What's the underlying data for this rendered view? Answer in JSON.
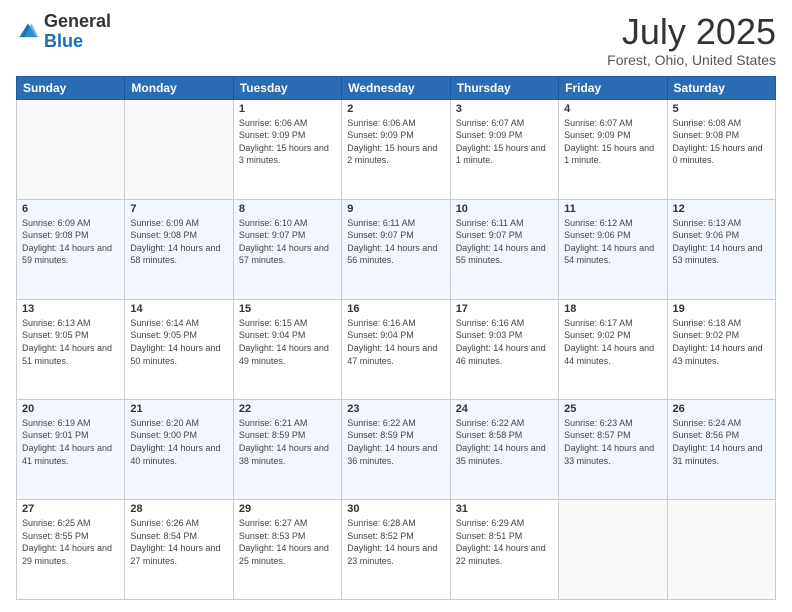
{
  "header": {
    "logo_line1": "General",
    "logo_line2": "Blue",
    "month": "July 2025",
    "location": "Forest, Ohio, United States"
  },
  "weekdays": [
    "Sunday",
    "Monday",
    "Tuesday",
    "Wednesday",
    "Thursday",
    "Friday",
    "Saturday"
  ],
  "weeks": [
    [
      {
        "day": "",
        "sunrise": "",
        "sunset": "",
        "daylight": ""
      },
      {
        "day": "",
        "sunrise": "",
        "sunset": "",
        "daylight": ""
      },
      {
        "day": "1",
        "sunrise": "Sunrise: 6:06 AM",
        "sunset": "Sunset: 9:09 PM",
        "daylight": "Daylight: 15 hours and 3 minutes."
      },
      {
        "day": "2",
        "sunrise": "Sunrise: 6:06 AM",
        "sunset": "Sunset: 9:09 PM",
        "daylight": "Daylight: 15 hours and 2 minutes."
      },
      {
        "day": "3",
        "sunrise": "Sunrise: 6:07 AM",
        "sunset": "Sunset: 9:09 PM",
        "daylight": "Daylight: 15 hours and 1 minute."
      },
      {
        "day": "4",
        "sunrise": "Sunrise: 6:07 AM",
        "sunset": "Sunset: 9:09 PM",
        "daylight": "Daylight: 15 hours and 1 minute."
      },
      {
        "day": "5",
        "sunrise": "Sunrise: 6:08 AM",
        "sunset": "Sunset: 9:08 PM",
        "daylight": "Daylight: 15 hours and 0 minutes."
      }
    ],
    [
      {
        "day": "6",
        "sunrise": "Sunrise: 6:09 AM",
        "sunset": "Sunset: 9:08 PM",
        "daylight": "Daylight: 14 hours and 59 minutes."
      },
      {
        "day": "7",
        "sunrise": "Sunrise: 6:09 AM",
        "sunset": "Sunset: 9:08 PM",
        "daylight": "Daylight: 14 hours and 58 minutes."
      },
      {
        "day": "8",
        "sunrise": "Sunrise: 6:10 AM",
        "sunset": "Sunset: 9:07 PM",
        "daylight": "Daylight: 14 hours and 57 minutes."
      },
      {
        "day": "9",
        "sunrise": "Sunrise: 6:11 AM",
        "sunset": "Sunset: 9:07 PM",
        "daylight": "Daylight: 14 hours and 56 minutes."
      },
      {
        "day": "10",
        "sunrise": "Sunrise: 6:11 AM",
        "sunset": "Sunset: 9:07 PM",
        "daylight": "Daylight: 14 hours and 55 minutes."
      },
      {
        "day": "11",
        "sunrise": "Sunrise: 6:12 AM",
        "sunset": "Sunset: 9:06 PM",
        "daylight": "Daylight: 14 hours and 54 minutes."
      },
      {
        "day": "12",
        "sunrise": "Sunrise: 6:13 AM",
        "sunset": "Sunset: 9:06 PM",
        "daylight": "Daylight: 14 hours and 53 minutes."
      }
    ],
    [
      {
        "day": "13",
        "sunrise": "Sunrise: 6:13 AM",
        "sunset": "Sunset: 9:05 PM",
        "daylight": "Daylight: 14 hours and 51 minutes."
      },
      {
        "day": "14",
        "sunrise": "Sunrise: 6:14 AM",
        "sunset": "Sunset: 9:05 PM",
        "daylight": "Daylight: 14 hours and 50 minutes."
      },
      {
        "day": "15",
        "sunrise": "Sunrise: 6:15 AM",
        "sunset": "Sunset: 9:04 PM",
        "daylight": "Daylight: 14 hours and 49 minutes."
      },
      {
        "day": "16",
        "sunrise": "Sunrise: 6:16 AM",
        "sunset": "Sunset: 9:04 PM",
        "daylight": "Daylight: 14 hours and 47 minutes."
      },
      {
        "day": "17",
        "sunrise": "Sunrise: 6:16 AM",
        "sunset": "Sunset: 9:03 PM",
        "daylight": "Daylight: 14 hours and 46 minutes."
      },
      {
        "day": "18",
        "sunrise": "Sunrise: 6:17 AM",
        "sunset": "Sunset: 9:02 PM",
        "daylight": "Daylight: 14 hours and 44 minutes."
      },
      {
        "day": "19",
        "sunrise": "Sunrise: 6:18 AM",
        "sunset": "Sunset: 9:02 PM",
        "daylight": "Daylight: 14 hours and 43 minutes."
      }
    ],
    [
      {
        "day": "20",
        "sunrise": "Sunrise: 6:19 AM",
        "sunset": "Sunset: 9:01 PM",
        "daylight": "Daylight: 14 hours and 41 minutes."
      },
      {
        "day": "21",
        "sunrise": "Sunrise: 6:20 AM",
        "sunset": "Sunset: 9:00 PM",
        "daylight": "Daylight: 14 hours and 40 minutes."
      },
      {
        "day": "22",
        "sunrise": "Sunrise: 6:21 AM",
        "sunset": "Sunset: 8:59 PM",
        "daylight": "Daylight: 14 hours and 38 minutes."
      },
      {
        "day": "23",
        "sunrise": "Sunrise: 6:22 AM",
        "sunset": "Sunset: 8:59 PM",
        "daylight": "Daylight: 14 hours and 36 minutes."
      },
      {
        "day": "24",
        "sunrise": "Sunrise: 6:22 AM",
        "sunset": "Sunset: 8:58 PM",
        "daylight": "Daylight: 14 hours and 35 minutes."
      },
      {
        "day": "25",
        "sunrise": "Sunrise: 6:23 AM",
        "sunset": "Sunset: 8:57 PM",
        "daylight": "Daylight: 14 hours and 33 minutes."
      },
      {
        "day": "26",
        "sunrise": "Sunrise: 6:24 AM",
        "sunset": "Sunset: 8:56 PM",
        "daylight": "Daylight: 14 hours and 31 minutes."
      }
    ],
    [
      {
        "day": "27",
        "sunrise": "Sunrise: 6:25 AM",
        "sunset": "Sunset: 8:55 PM",
        "daylight": "Daylight: 14 hours and 29 minutes."
      },
      {
        "day": "28",
        "sunrise": "Sunrise: 6:26 AM",
        "sunset": "Sunset: 8:54 PM",
        "daylight": "Daylight: 14 hours and 27 minutes."
      },
      {
        "day": "29",
        "sunrise": "Sunrise: 6:27 AM",
        "sunset": "Sunset: 8:53 PM",
        "daylight": "Daylight: 14 hours and 25 minutes."
      },
      {
        "day": "30",
        "sunrise": "Sunrise: 6:28 AM",
        "sunset": "Sunset: 8:52 PM",
        "daylight": "Daylight: 14 hours and 23 minutes."
      },
      {
        "day": "31",
        "sunrise": "Sunrise: 6:29 AM",
        "sunset": "Sunset: 8:51 PM",
        "daylight": "Daylight: 14 hours and 22 minutes."
      },
      {
        "day": "",
        "sunrise": "",
        "sunset": "",
        "daylight": ""
      },
      {
        "day": "",
        "sunrise": "",
        "sunset": "",
        "daylight": ""
      }
    ]
  ]
}
